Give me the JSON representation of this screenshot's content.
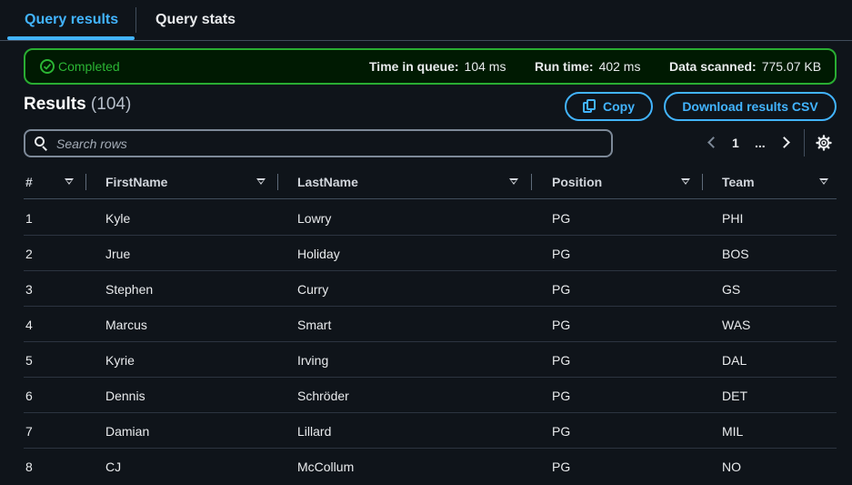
{
  "tabs": [
    {
      "label": "Query results"
    },
    {
      "label": "Query stats"
    }
  ],
  "status": {
    "state": "Completed",
    "time_in_queue_label": "Time in queue:",
    "time_in_queue_value": "104 ms",
    "run_time_label": "Run time:",
    "run_time_value": "402 ms",
    "data_scanned_label": "Data scanned:",
    "data_scanned_value": "775.07 KB",
    "accent": "#2bb534"
  },
  "results": {
    "title": "Results",
    "count": "(104)",
    "copy_label": "Copy",
    "download_label": "Download results CSV"
  },
  "search": {
    "placeholder": "Search rows"
  },
  "pagination": {
    "current_page": "1",
    "ellipsis": "..."
  },
  "table": {
    "columns": [
      "#",
      "FirstName",
      "LastName",
      "Position",
      "Team"
    ],
    "rows": [
      [
        "1",
        "Kyle",
        "Lowry",
        "PG",
        "PHI"
      ],
      [
        "2",
        "Jrue",
        "Holiday",
        "PG",
        "BOS"
      ],
      [
        "3",
        "Stephen",
        "Curry",
        "PG",
        "GS"
      ],
      [
        "4",
        "Marcus",
        "Smart",
        "PG",
        "WAS"
      ],
      [
        "5",
        "Kyrie",
        "Irving",
        "PG",
        "DAL"
      ],
      [
        "6",
        "Dennis",
        "Schröder",
        "PG",
        "DET"
      ],
      [
        "7",
        "Damian",
        "Lillard",
        "PG",
        "MIL"
      ],
      [
        "8",
        "CJ",
        "McCollum",
        "PG",
        "NO"
      ]
    ]
  },
  "colors": {
    "link": "#42b4ff",
    "success": "#2bb534",
    "background": "#0f141a"
  }
}
